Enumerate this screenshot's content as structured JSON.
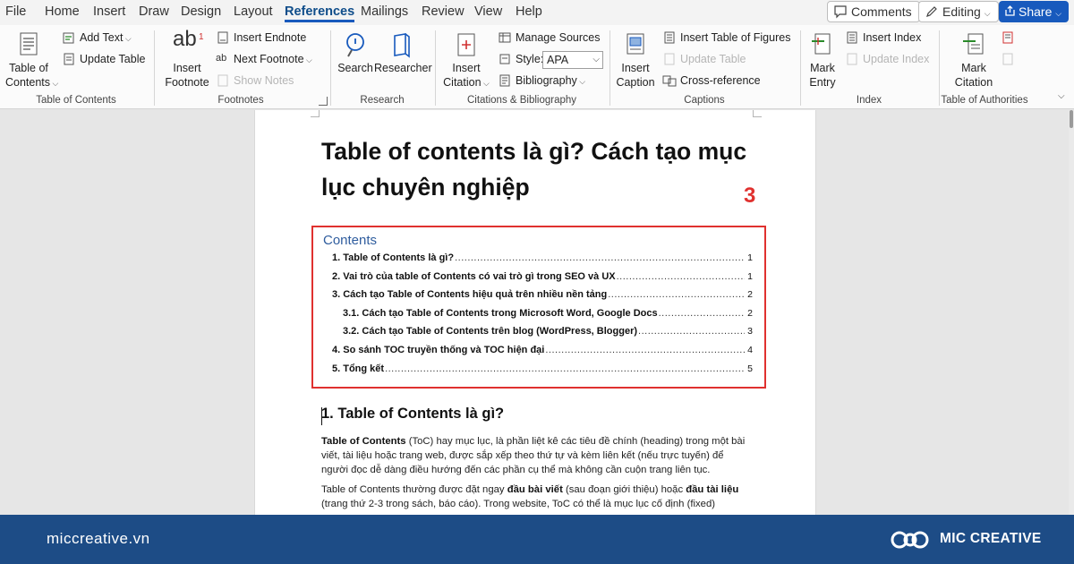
{
  "menu": {
    "tabs": [
      "File",
      "Home",
      "Insert",
      "Draw",
      "Design",
      "Layout",
      "References",
      "Mailings",
      "Review",
      "View",
      "Help"
    ],
    "active_tab": "References",
    "comments_label": "Comments",
    "editing_label": "Editing",
    "share_label": "Share"
  },
  "ribbon": {
    "toc": {
      "big_label_1": "Table of",
      "big_label_2": "Contents",
      "add_text": "Add Text",
      "update_table": "Update Table",
      "group_label": "Table of Contents"
    },
    "footnotes": {
      "big_label_1": "Insert",
      "big_label_2": "Footnote",
      "insert_endnote": "Insert Endnote",
      "next_footnote": "Next Footnote",
      "show_notes": "Show Notes",
      "group_label": "Footnotes",
      "icon_text": "ab",
      "icon_sup": "1"
    },
    "research": {
      "search": "Search",
      "researcher": "Researcher",
      "group_label": "Research"
    },
    "citations": {
      "big_label_1": "Insert",
      "big_label_2": "Citation",
      "manage_sources": "Manage Sources",
      "style_label": "Style:",
      "style_value": "APA",
      "bibliography": "Bibliography",
      "group_label": "Citations & Bibliography"
    },
    "captions": {
      "big_label_1": "Insert",
      "big_label_2": "Caption",
      "insert_table_of_figures": "Insert Table of Figures",
      "update_table": "Update Table",
      "cross_reference": "Cross-reference",
      "group_label": "Captions"
    },
    "index": {
      "big_label_1": "Mark",
      "big_label_2": "Entry",
      "insert_index": "Insert Index",
      "update_index": "Update Index",
      "group_label": "Index"
    },
    "authorities": {
      "big_label_1": "Mark",
      "big_label_2": "Citation",
      "group_label": "Table of Authorities"
    }
  },
  "document": {
    "title": "Table of contents là gì? Cách tạo mục lục chuyên nghiệp",
    "annotation_number": "3",
    "toc_heading": "Contents",
    "toc_entries": [
      {
        "text": "1. Table of Contents là gì?",
        "page": "1"
      },
      {
        "text": "2. Vai trò của table of Contents có vai trò gì trong SEO và UX",
        "page": "1"
      },
      {
        "text": "3. Cách tạo Table of Contents hiệu quả trên nhiều nền tảng",
        "page": "2"
      },
      {
        "text": "3.1. Cách tạo Table of Contents trong Microsoft Word, Google Docs",
        "page": "2"
      },
      {
        "text": "3.2. Cách tạo Table of Contents trên blog (WordPress, Blogger)",
        "page": "3"
      },
      {
        "text": "4. So sánh TOC truyền thống và TOC hiện đại",
        "page": "4"
      },
      {
        "text": "5. Tổng kết",
        "page": "5"
      }
    ],
    "heading_1": "1. Table of Contents là gì?",
    "para1": {
      "bold_lead": "Table of Contents",
      "rest": " (ToC) hay mục lục, là phần liệt kê các tiêu đề chính (heading) trong một bài viết, tài liệu hoặc trang web, được sắp xếp theo thứ tự và kèm liên kết (nếu trực tuyến) để người đọc dễ dàng điều hướng đến các phần cụ thể mà không cần cuộn trang liên tục."
    },
    "para2": {
      "part1": "Table of Contents thường được đặt ngay ",
      "bold1": "đầu bài viết",
      "part2": " (sau đoạn giới thiệu) hoặc ",
      "bold2": "đầu tài liệu",
      "part3": " (trang thứ 2-3 trong sách, báo cáo). Trong website, ToC có thể là mục lục cố định (fixed)"
    }
  },
  "footer": {
    "website": "miccreative.vn",
    "brand": "MIC CREATIVE"
  },
  "colors": {
    "accent_blue": "#185abd",
    "highlight_red": "#e0312f",
    "footer_bg": "#1d4c86",
    "toc_heading_blue": "#2f5d9e"
  }
}
